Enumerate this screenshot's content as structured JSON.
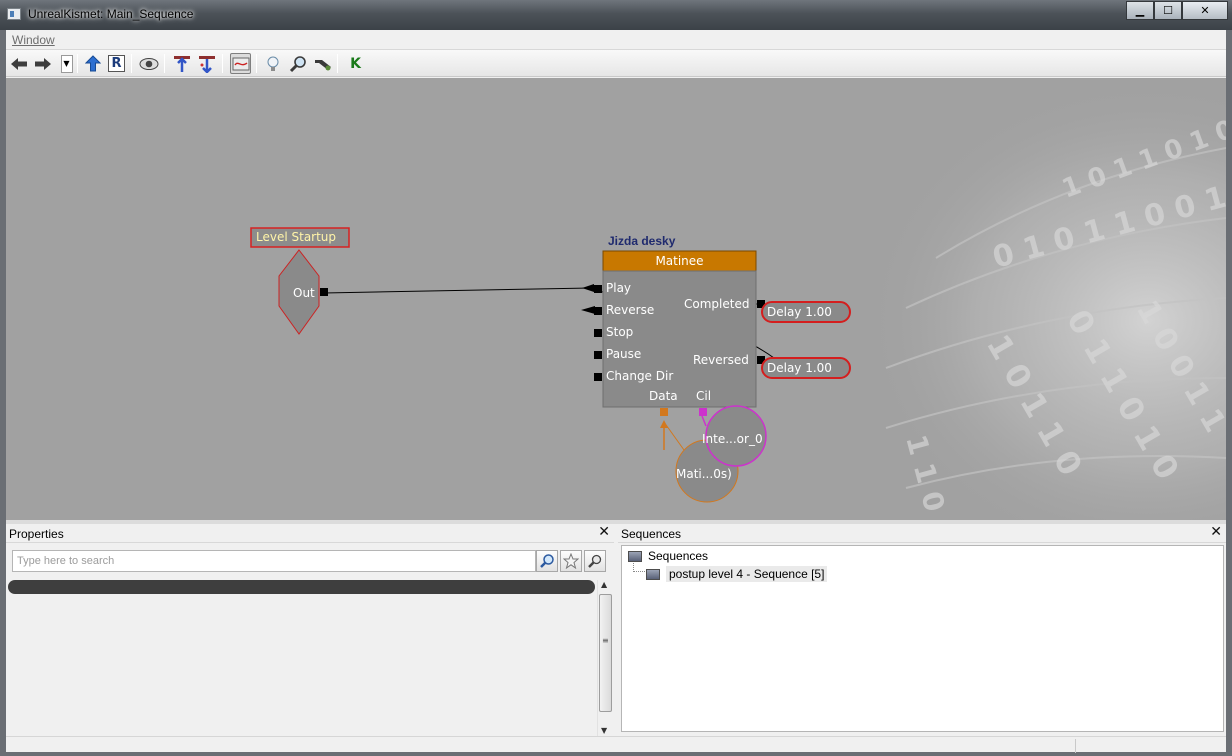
{
  "window": {
    "title": "UnrealKismet: Main_Sequence",
    "minimize": "▁",
    "maximize": "☐",
    "close": "✕"
  },
  "menubar": {
    "window_menu": "Window"
  },
  "toolbar": {
    "buttons": [
      "back-arrow-icon",
      "forward-arrow-icon",
      "history-dropdown",
      "parent-sequence-icon",
      "rename-sequence-icon",
      "hide-unused-connectors-icon",
      "open-new-window-icon",
      "create-sequence-icon",
      "curved-lines-icon",
      "lightbulb-icon",
      "search-icon",
      "update-sequence-icon",
      "kismet-debugger-icon"
    ],
    "rename_glyph": "R",
    "kismet_glyph": "K"
  },
  "canvas": {
    "event_node": {
      "title": "Level Startup",
      "output": "Out"
    },
    "matinee_node": {
      "comment": "Jizda desky",
      "title": "Matinee",
      "inputs": [
        "Play",
        "Reverse",
        "Stop",
        "Pause",
        "Change Dir"
      ],
      "outputs": [
        "Completed",
        "Reversed"
      ],
      "vars": [
        "Data",
        "Cil"
      ]
    },
    "delay_nodes": [
      "Delay 1.00",
      "Delay 1.00"
    ],
    "var_nodes": [
      "Inte...or_0",
      "Mati...0s)"
    ]
  },
  "properties": {
    "title": "Properties",
    "search_placeholder": "Type here to search"
  },
  "sequences": {
    "title": "Sequences",
    "root": "Sequences",
    "child": "postup level 4 - Sequence [5]"
  },
  "colors": {
    "canvas_bg": "#a0a0a0",
    "matinee_header": "#c87800",
    "delay_border": "#d41e1e",
    "event_border": "#cc2222",
    "cil_var": "#cc33cc",
    "data_var": "#d2781e"
  }
}
